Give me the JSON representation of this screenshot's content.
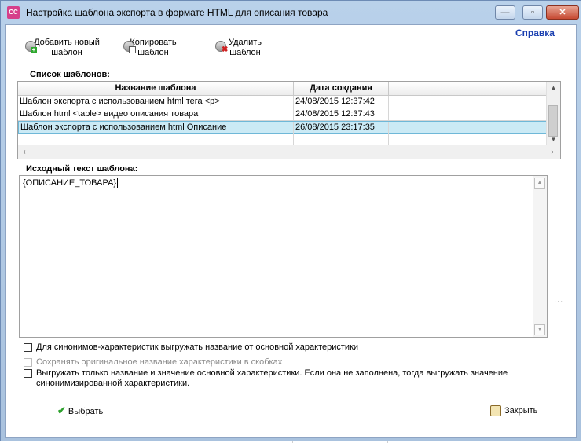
{
  "window": {
    "icon_text": "CC",
    "title": "Настройка шаблона экспорта в формате HTML для описания товара",
    "controls": {
      "minimize": "—",
      "maximize": "▫",
      "close": "✕"
    }
  },
  "help_link": "Справка",
  "toolbar": {
    "add_line1": "Добавить новый",
    "add_line2": "шаблон",
    "copy_line1": "Копировать",
    "copy_line2": "шаблон",
    "delete_line1": "Удалить",
    "delete_line2": "шаблон"
  },
  "templates": {
    "section_label": "Список шаблонов:",
    "columns": [
      "Название шаблона",
      "Дата создания"
    ],
    "rows": [
      {
        "name": "Шаблон экспорта с использованием html тега <p>",
        "date": "24/08/2015 12:37:42"
      },
      {
        "name": "Шаблон html <table> видео описания товара",
        "date": "24/08/2015 12:37:43"
      },
      {
        "name": "Шаблон экспорта с использованием html Описание",
        "date": "26/08/2015 23:17:35"
      }
    ],
    "selected_row": 2
  },
  "source": {
    "section_label": "Исходный текст шаблона:",
    "text": "{ОПИСАНИЕ_ТОВАРА}",
    "ellipsis": "..."
  },
  "options": {
    "synonyms_label": "Для синонимов-характеристик выгружать название от основной характеристики",
    "keep_original_label": "Сохранять оригинальное название характеристики в скобках",
    "main_only_line1": "Выгружать только название и значение основной характеристики. Если она не заполнена, тогда выгружать значение",
    "main_only_line2": "синонимизированной характеристики."
  },
  "buttons": {
    "select": "Выбрать",
    "close": "Закрыть"
  },
  "colors": {
    "selected_row": "#cbeaf5",
    "help_link": "#1a3fb0",
    "title_close": "#c74a33"
  }
}
